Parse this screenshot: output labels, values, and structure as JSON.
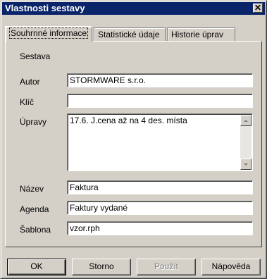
{
  "window": {
    "title": "Vlastnosti sestavy",
    "close_glyph": "✕"
  },
  "tabs": [
    {
      "label": "Souhrnné informace",
      "active": true
    },
    {
      "label": "Statistické údaje",
      "active": false
    },
    {
      "label": "Historie úprav",
      "active": false
    }
  ],
  "form": {
    "section_label": "Sestava",
    "autor_label": "Autor",
    "autor_value": "STORMWARE s.r.o.",
    "klic_label": "Klíč",
    "klic_value": "",
    "upravy_label": "Úpravy",
    "upravy_value": "17.6. J.cena až na 4 des. místa",
    "nazev_label": "Název",
    "nazev_value": "Faktura",
    "agenda_label": "Agenda",
    "agenda_value": "Faktury vydané",
    "sablona_label": "Šablona",
    "sablona_value": "vzor.rph"
  },
  "buttons": {
    "ok": "OK",
    "storno": "Storno",
    "pouzit": "Použít",
    "napoveda": "Nápověda"
  },
  "icons": {
    "scroll_up": "scroll-up-arrow-icon",
    "scroll_down": "scroll-down-arrow-icon",
    "close": "close-icon"
  }
}
